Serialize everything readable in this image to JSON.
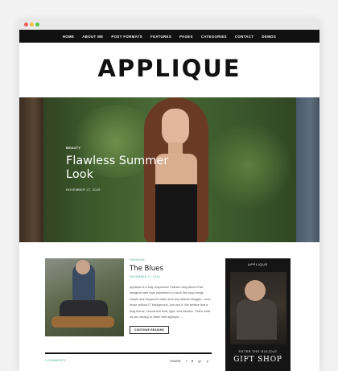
{
  "nav": {
    "items": [
      "HOME",
      "ABOUT ME",
      "POST FORMATS",
      "FEATURES",
      "PAGES",
      "CATEGORIES",
      "CONTACT",
      "DEMOS"
    ]
  },
  "site": {
    "logo": "APPLIQUE"
  },
  "hero": {
    "tag": "BEAUTY",
    "title": "Flawless Summer Look",
    "date": "NOVEMBER 27, 2015"
  },
  "post": {
    "category": "FASHION",
    "title": "The Blues",
    "date": "NOVEMBER 27, 2015",
    "excerpt": "Applique is a fully responsive Fashion blog theme that designed with style publishers in mind! We keep things simple and elegant to make sure any fashion blogger—even those without IT background, can use it. We believe that a blog theme, should feel fluid, light, and intuitive. That's what we are aiming to make with applique, ...",
    "read_label": "CONTINUE READING",
    "comments": "3 COMMENTS",
    "share_label": "SHARE",
    "share_icons": [
      "f",
      "♥",
      "g+",
      "p"
    ]
  },
  "ad": {
    "brand": "APPLIQUE",
    "kicker": "ENTER THE HOLIDAY",
    "title": "GIFT SHOP"
  },
  "colors": {
    "accent": "#3aa68c",
    "nav_bg": "#111111"
  }
}
